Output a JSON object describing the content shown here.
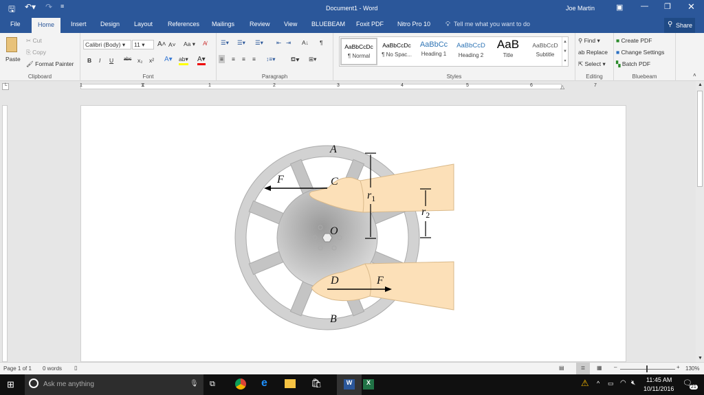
{
  "titlebar": {
    "title": "Document1 - Word",
    "user": "Joe Martin",
    "icons": [
      "save-icon",
      "undo-icon",
      "redo-icon",
      "customize-qat-icon",
      "ribbon-display-icon",
      "minimize-icon",
      "restore-icon",
      "close-icon"
    ]
  },
  "tabs": [
    "File",
    "Home",
    "Insert",
    "Design",
    "Layout",
    "References",
    "Mailings",
    "Review",
    "View",
    "BLUEBEAM",
    "Foxit PDF",
    "Nitro Pro 10"
  ],
  "tell_me": "Tell me what you want to do",
  "share": "Share",
  "clipboard": {
    "paste": "Paste",
    "cut": "Cut",
    "copy": "Copy",
    "format_painter": "Format Painter",
    "label": "Clipboard"
  },
  "font": {
    "name": "Calibri (Body)",
    "size": "11",
    "change_case": "Aa",
    "label": "Font",
    "buttons": [
      "B",
      "I",
      "U",
      "abc",
      "x₂",
      "x²"
    ]
  },
  "paragraph": {
    "label": "Paragraph"
  },
  "styles": {
    "label": "Styles",
    "items": [
      {
        "preview": "AaBbCcDc",
        "name": "¶ Normal"
      },
      {
        "preview": "AaBbCcDc",
        "name": "¶ No Spac..."
      },
      {
        "preview": "AaBbCc",
        "name": "Heading 1"
      },
      {
        "preview": "AaBbCcD",
        "name": "Heading 2"
      },
      {
        "preview": "AaB",
        "name": "Title"
      },
      {
        "preview": "AaBbCcD",
        "name": "Subtitle"
      }
    ]
  },
  "editing": {
    "find": "Find",
    "replace": "Replace",
    "select": "Select",
    "label": "Editing"
  },
  "bluebeam": {
    "create": "Create PDF",
    "settings": "Change Settings",
    "batch": "Batch PDF",
    "label": "Bluebeam"
  },
  "ruler": [
    "1",
    "1",
    "2",
    "3",
    "4",
    "5",
    "6",
    "7"
  ],
  "figure": {
    "A": "A",
    "B": "B",
    "C": "C",
    "D": "D",
    "O": "O",
    "F1": "F",
    "F2": "F",
    "r1": "r",
    "r1_sub": "1",
    "r2": "r",
    "r2_sub": "2"
  },
  "status": {
    "page": "Page 1 of 1",
    "words": "0 words",
    "zoom": "130%",
    "zoom_level_percent": 130
  },
  "taskbar": {
    "search": "Ask me anything",
    "time": "11:45 AM",
    "date": "10/11/2016",
    "notifications": "21"
  }
}
